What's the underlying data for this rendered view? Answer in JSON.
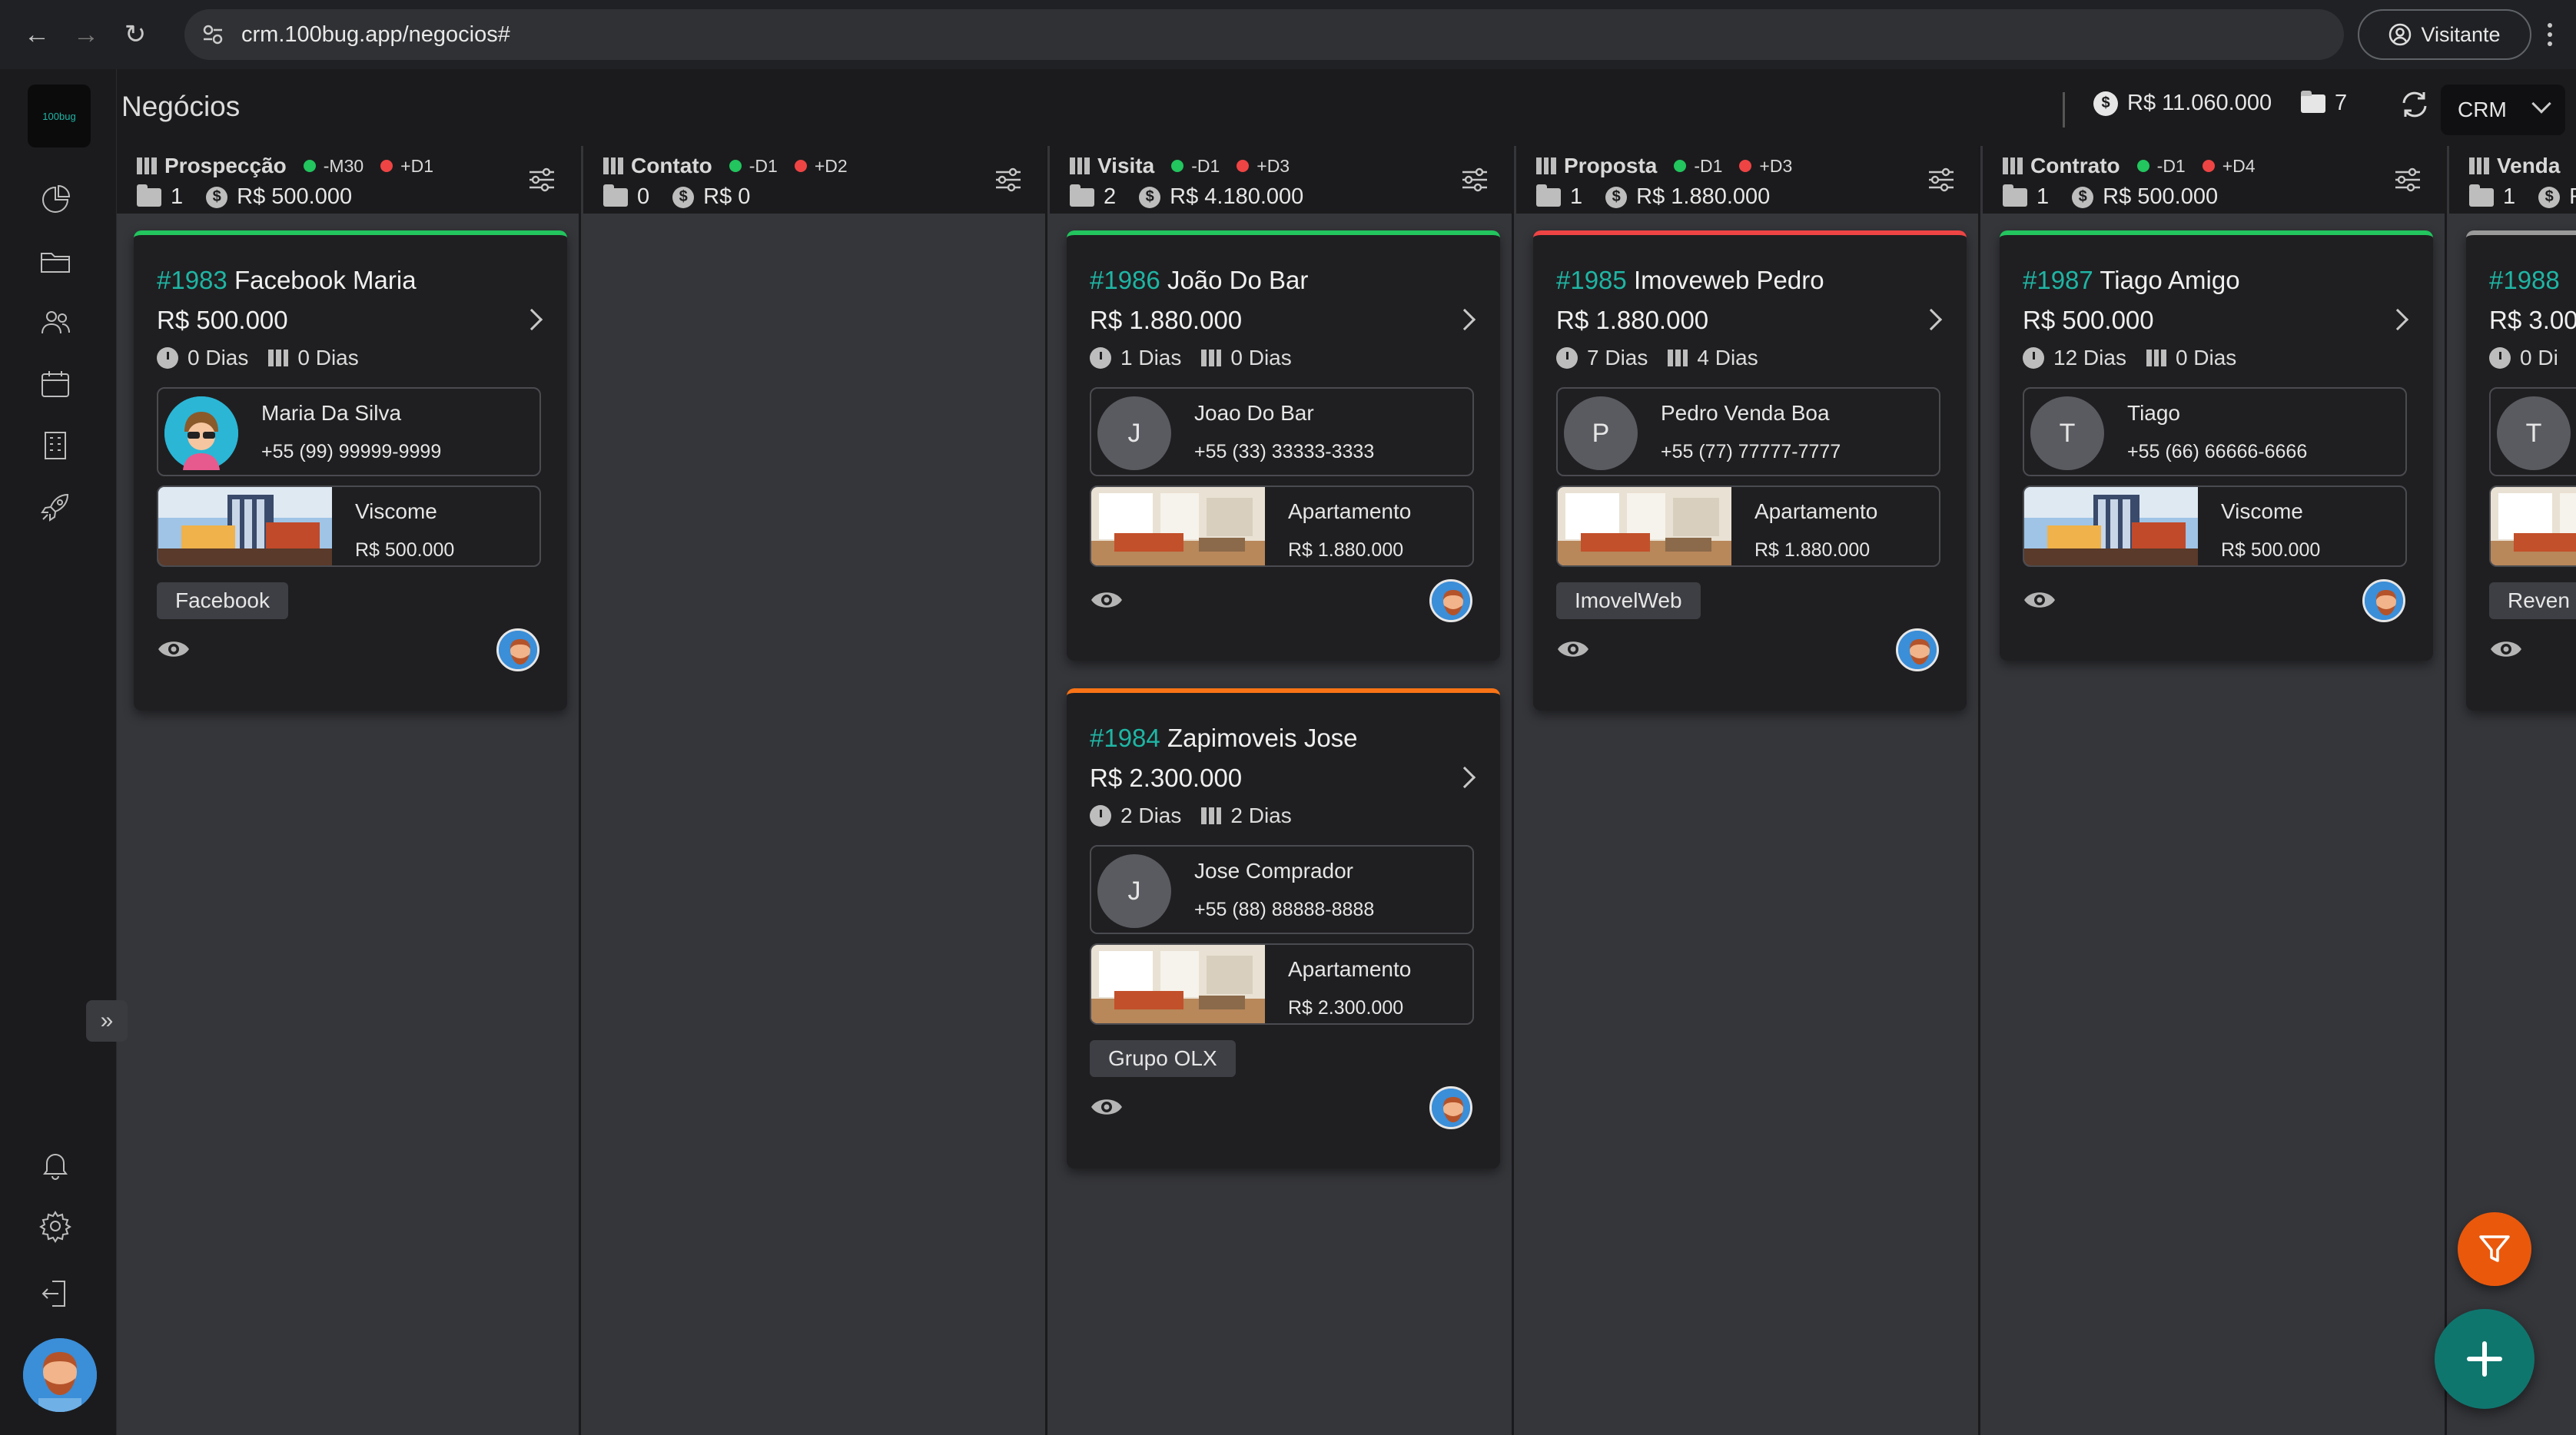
{
  "browser": {
    "url": "crm.100bug.app/negocios#",
    "profile_label": "Visitante"
  },
  "sidebar": {
    "logo_text": "100bug",
    "items": [
      {
        "icon": "chart-pie-icon"
      },
      {
        "icon": "folder-icon"
      },
      {
        "icon": "users-icon"
      },
      {
        "icon": "calendar-icon"
      },
      {
        "icon": "building-icon"
      },
      {
        "icon": "rocket-icon"
      }
    ],
    "bottom_items": [
      {
        "icon": "bell-icon"
      },
      {
        "icon": "gear-icon"
      },
      {
        "icon": "logout-icon"
      }
    ]
  },
  "header": {
    "title": "Negócios",
    "total_value": "R$ 11.060.000",
    "total_count": "7",
    "pipeline_select": "CRM"
  },
  "columns": [
    {
      "name": "Prospecção",
      "tag1": "-M30",
      "tag2": "+D1",
      "count": "1",
      "value": "R$ 500.000",
      "cards": [
        {
          "num": "#1983",
          "title": "Facebook Maria",
          "value": "R$ 500.000",
          "days1": "0 Dias",
          "days2": "0 Dias",
          "contact_name": "Maria Da Silva",
          "contact_phone": "+55 (99) 99999-9999",
          "contact_initial": "",
          "product_name": "Viscome",
          "product_value": "R$ 500.000",
          "chip": "Facebook",
          "accent": "green"
        }
      ]
    },
    {
      "name": "Contato",
      "tag1": "-D1",
      "tag2": "+D2",
      "count": "0",
      "value": "R$ 0",
      "cards": []
    },
    {
      "name": "Visita",
      "tag1": "-D1",
      "tag2": "+D3",
      "count": "2",
      "value": "R$ 4.180.000",
      "cards": [
        {
          "num": "#1986",
          "title": "João Do Bar",
          "value": "R$ 1.880.000",
          "days1": "1 Dias",
          "days2": "0 Dias",
          "contact_name": "Joao Do Bar",
          "contact_phone": "+55 (33) 33333-3333",
          "contact_initial": "J",
          "product_name": "Apartamento",
          "product_value": "R$ 1.880.000",
          "chip": "",
          "accent": "green"
        },
        {
          "num": "#1984",
          "title": "Zapimoveis Jose",
          "value": "R$ 2.300.000",
          "days1": "2 Dias",
          "days2": "2 Dias",
          "contact_name": "Jose Comprador",
          "contact_phone": "+55 (88) 88888-8888",
          "contact_initial": "J",
          "product_name": "Apartamento",
          "product_value": "R$ 2.300.000",
          "chip": "Grupo OLX",
          "accent": "orange"
        }
      ]
    },
    {
      "name": "Proposta",
      "tag1": "-D1",
      "tag2": "+D3",
      "count": "1",
      "value": "R$ 1.880.000",
      "cards": [
        {
          "num": "#1985",
          "title": "Imoveweb Pedro",
          "value": "R$ 1.880.000",
          "days1": "7 Dias",
          "days2": "4 Dias",
          "contact_name": "Pedro Venda Boa",
          "contact_phone": "+55 (77) 77777-7777",
          "contact_initial": "P",
          "product_name": "Apartamento",
          "product_value": "R$ 1.880.000",
          "chip": "ImovelWeb",
          "accent": "red"
        }
      ]
    },
    {
      "name": "Contrato",
      "tag1": "-D1",
      "tag2": "+D4",
      "count": "1",
      "value": "R$ 500.000",
      "cards": [
        {
          "num": "#1987",
          "title": "Tiago Amigo",
          "value": "R$ 500.000",
          "days1": "12 Dias",
          "days2": "0 Dias",
          "contact_name": "Tiago",
          "contact_phone": "+55 (66) 66666-6666",
          "contact_initial": "T",
          "product_name": "Viscome",
          "product_value": "R$ 500.000",
          "chip": "",
          "accent": "green"
        }
      ]
    },
    {
      "name": "Venda",
      "tag1": "",
      "tag2": "",
      "count": "1",
      "value": "R",
      "cards": [
        {
          "num": "#1988",
          "title": "",
          "value": "R$ 3.00",
          "days1": "0 Di",
          "days2": "",
          "contact_name": "",
          "contact_phone": "",
          "contact_initial": "T",
          "product_name": "",
          "product_value": "",
          "chip": "Reven",
          "accent": "gray"
        }
      ]
    }
  ],
  "colors": {
    "accent_teal": "#1fb5a4",
    "green": "#22c55e",
    "red": "#ef4444",
    "orange": "#f97316",
    "fab_filter": "#ea580c",
    "fab_add": "#0f766e"
  }
}
